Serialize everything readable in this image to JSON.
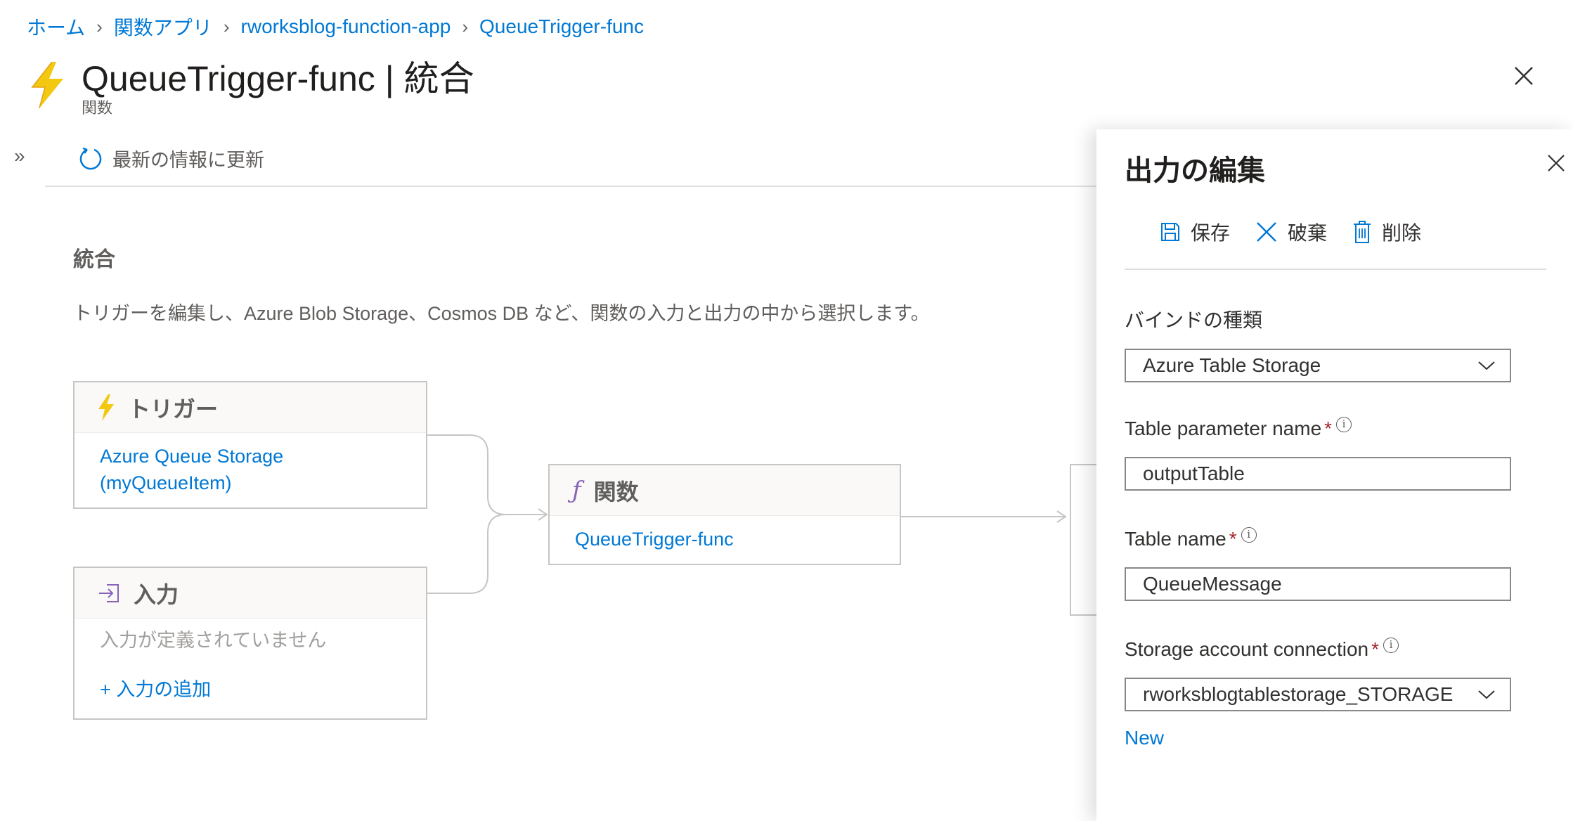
{
  "breadcrumb": [
    "ホーム",
    "関数アプリ",
    "rworksblog-function-app",
    "QueueTrigger-func"
  ],
  "header": {
    "title": "QueueTrigger-func | 統合",
    "subtitle": "関数"
  },
  "toolbar": {
    "expand_glyph": "»",
    "refresh_label": "最新の情報に更新"
  },
  "main": {
    "section_title": "統合",
    "description": "トリガーを編集し、Azure Blob Storage、Cosmos DB など、関数の入力と出力の中から選択します。",
    "trigger": {
      "title": "トリガー",
      "link_line1": "Azure Queue Storage",
      "link_line2": "(myQueueItem)"
    },
    "input": {
      "title": "入力",
      "empty_text": "入力が定義されていません",
      "add_link": "+ 入力の追加"
    },
    "function": {
      "title": "関数",
      "link": "QueueTrigger-func"
    }
  },
  "panel": {
    "title": "出力の編集",
    "actions": {
      "save": "保存",
      "discard": "破棄",
      "delete": "削除"
    },
    "binding_type": {
      "label": "バインドの種類",
      "value": "Azure Table Storage"
    },
    "table_param": {
      "label": "Table parameter name",
      "value": "outputTable"
    },
    "table_name": {
      "label": "Table name",
      "value": "QueueMessage"
    },
    "storage_conn": {
      "label": "Storage account connection",
      "value": "rworksblogtablestorage_STORAGE"
    },
    "required_mark": "*",
    "info_glyph": "i",
    "new_link": "New"
  },
  "colors": {
    "accent": "#0078d4",
    "required": "#a4262c",
    "bolt": "#f2c811"
  }
}
